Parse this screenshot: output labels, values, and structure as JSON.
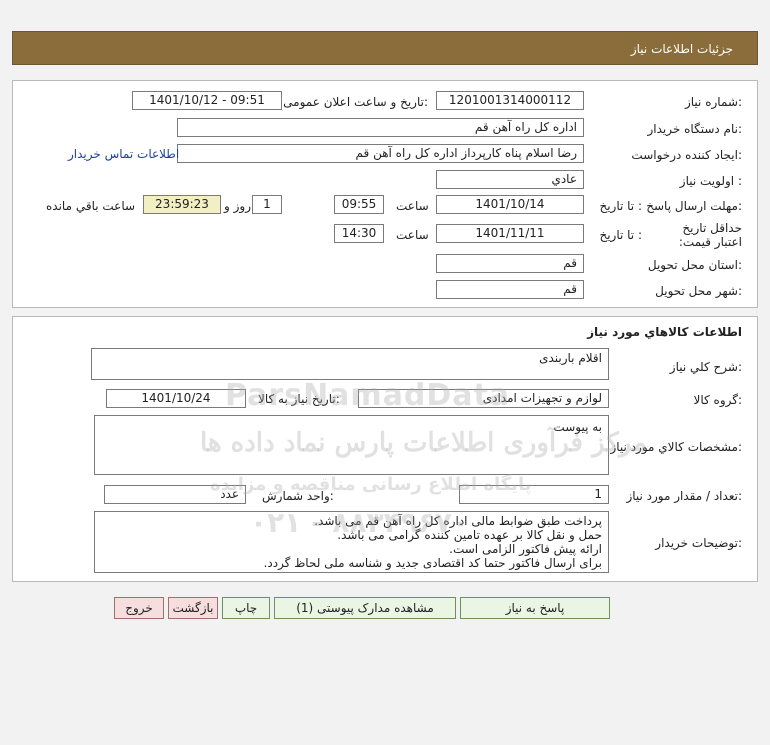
{
  "header": {
    "title": "جزئیات اطلاعات نیاز"
  },
  "need_info": {
    "need_number_label": "شماره نیاز:",
    "need_number": "1201001314000112",
    "announce_label": "تاریخ و ساعت اعلان عمومی:",
    "announce_value": "1401/10/12 - 09:51",
    "buyer_org_label": "نام دستگاه خریدار:",
    "buyer_org": "اداره کل  راه آهن قم",
    "creator_label": "ایجاد کننده درخواست:",
    "creator": "رضا اسلام پناه کارپرداز اداره کل  راه آهن قم",
    "contact_link": "اطلاعات تماس خریدار",
    "priority_label": "اولویت نیاز :",
    "priority": "عادي",
    "send_deadline_label": "مهلت ارسال پاسخ:",
    "to_date_label": "تا تاریخ :",
    "send_date": "1401/10/14",
    "time_label": "ساعت",
    "send_time": "09:55",
    "days_value": "1",
    "days_label": "روز و",
    "remaining_time": "23:59:23",
    "remaining_label": "ساعت باقي مانده",
    "validity_label": "حداقل تاریخ اعتبار قیمت:",
    "validity_date": "1401/11/11",
    "validity_time": "14:30",
    "province_label": "استان محل تحویل:",
    "province": "قم",
    "city_label": "شهر محل تحویل:",
    "city": "قم"
  },
  "goods": {
    "section_title": "اطلاعات کالاهاي مورد نياز",
    "general_desc_label": "شرح کلي نياز:",
    "general_desc": "اقلام باربندی",
    "group_label": "گروه کالا:",
    "group": "لوازم و تجهیزات امدادی",
    "need_date_label": "تاریخ نیاز به کالا:",
    "need_date": "1401/10/24",
    "specs_label": "مشخصات کالاي مورد نياز:",
    "specs": "به پیوست",
    "qty_label": "تعداد / مقدار مورد نیاز:",
    "qty": "1",
    "unit_label": "واحد شمارش:",
    "unit": "عدد",
    "buyer_notes_label": "توضیحات خریدار:",
    "buyer_notes": [
      "پرداخت طبق ضوابط مالی اداره کل راه آهن قم می باشد.",
      "حمل و نقل کالا بر عهده تامین کننده گرامی می باشد.",
      "ارائه پیش فاکتور الزامی است.",
      "برای ارسال فاکتور حتما کد اقتصادی جدید و شناسه ملی لحاظ گردد."
    ]
  },
  "buttons": {
    "reply": "پاسخ به نیاز",
    "view_docs": "مشاهده مدارک پیوستی (1)",
    "print": "چاپ",
    "back": "بازگشت",
    "exit": "خروج"
  },
  "watermark": {
    "line1": "ParsNamadData",
    "line2": "مرکز فرآوری اطلاعات پارس نماد داده ها",
    "line3": "پایگاه اطلاع رسانی مناقصه و مزایده",
    "line4": "۰۲۱ - ۸۸۳۴۹۶۷۰"
  }
}
